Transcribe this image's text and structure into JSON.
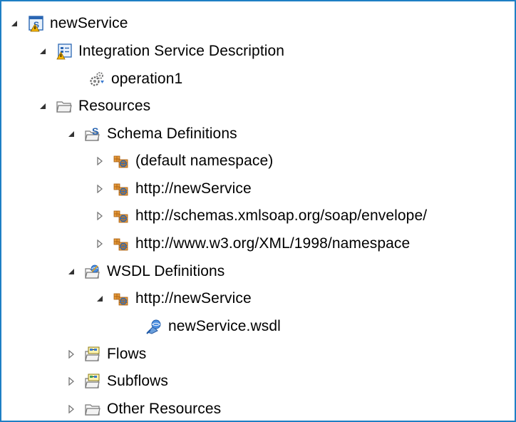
{
  "tree": {
    "root": {
      "label": "newService",
      "expanded": true,
      "icon": "service-icon"
    },
    "isd": {
      "label": "Integration Service Description",
      "expanded": true,
      "icon": "service-description-icon"
    },
    "operation": {
      "label": "operation1",
      "icon": "operation-icon"
    },
    "resources": {
      "label": "Resources",
      "expanded": true,
      "icon": "folder-icon"
    },
    "schema_defs": {
      "label": "Schema Definitions",
      "expanded": true,
      "icon": "schema-folder-icon"
    },
    "schema_items": [
      {
        "label": "(default namespace)",
        "expanded": false,
        "icon": "namespace-icon"
      },
      {
        "label": "http://newService",
        "expanded": false,
        "icon": "namespace-icon"
      },
      {
        "label": "http://schemas.xmlsoap.org/soap/envelope/",
        "expanded": false,
        "icon": "namespace-icon"
      },
      {
        "label": "http://www.w3.org/XML/1998/namespace",
        "expanded": false,
        "icon": "namespace-icon"
      }
    ],
    "wsdl_defs": {
      "label": "WSDL Definitions",
      "expanded": true,
      "icon": "wsdl-folder-icon"
    },
    "wsdl_ns": {
      "label": "http://newService",
      "expanded": true,
      "icon": "namespace-icon"
    },
    "wsdl_file": {
      "label": "newService.wsdl",
      "icon": "wsdl-file-icon"
    },
    "flows": {
      "label": "Flows",
      "expanded": false,
      "icon": "flows-folder-icon"
    },
    "subflows": {
      "label": "Subflows",
      "expanded": false,
      "icon": "subflows-folder-icon"
    },
    "other": {
      "label": "Other Resources",
      "expanded": false,
      "icon": "folder-icon"
    }
  },
  "colors": {
    "border": "#1e7fc4",
    "twisty": "#333333",
    "namespace_icon": "#c8741a",
    "warning": "#f5b400"
  }
}
